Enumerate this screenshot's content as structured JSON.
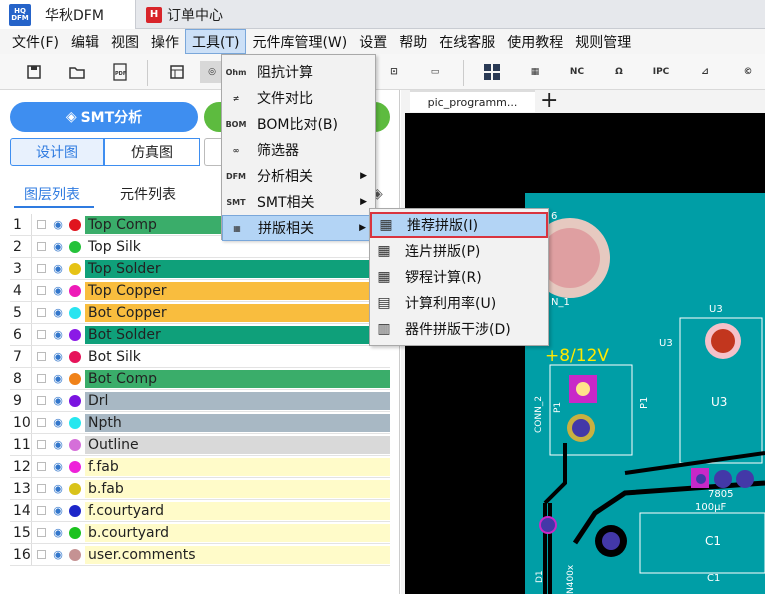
{
  "app_tabs": [
    {
      "logo": "HQ DFM",
      "label": "华秋DFM"
    },
    {
      "logo": "H",
      "label": "订单中心"
    }
  ],
  "menu": [
    "文件(F)",
    "编辑",
    "视图",
    "操作",
    "工具(T)",
    "元件库管理(W)",
    "设置",
    "帮助",
    "在线客服",
    "使用教程",
    "规则管理"
  ],
  "toolbar_icons": [
    "save-icon",
    "open-icon",
    "pdf-icon",
    "layout-icon",
    "ohm-icon",
    "ohm2-icon",
    "component-icon",
    "ruler-icon",
    "panel-icon",
    "grid-icon",
    "nc-icon",
    "ohm-icon",
    "ipc-icon",
    "probe-icon",
    "copyright-icon"
  ],
  "left": {
    "smt_button": "SMT分析",
    "seg_design": "设计图",
    "seg_sim": "仿真图",
    "tab_layers": "图层列表",
    "tab_components": "元件列表",
    "layers": [
      {
        "n": "1",
        "name": "Top Comp",
        "dot": "#e0141e",
        "bg": "#3aad6a"
      },
      {
        "n": "2",
        "name": "Top Silk",
        "dot": "#25c23a",
        "bg": "#ffffff"
      },
      {
        "n": "3",
        "name": "Top Solder",
        "dot": "#e6c315",
        "bg": "#0fa07a"
      },
      {
        "n": "4",
        "name": "Top Copper",
        "dot": "#ee1ab7",
        "bg": "#f9bd3e"
      },
      {
        "n": "5",
        "name": "Bot Copper",
        "dot": "#2ae4f0",
        "bg": "#f9bd3e"
      },
      {
        "n": "6",
        "name": "Bot Solder",
        "dot": "#8b1ae6",
        "bg": "#0fa07a"
      },
      {
        "n": "7",
        "name": "Bot Silk",
        "dot": "#e6145a",
        "bg": "#ffffff"
      },
      {
        "n": "8",
        "name": "Bot Comp",
        "dot": "#f08219",
        "bg": "#3aad6a"
      },
      {
        "n": "9",
        "name": "Drl",
        "dot": "#7a14e0",
        "bg": "#a8b8c4"
      },
      {
        "n": "10",
        "name": "Npth",
        "dot": "#27e7ef",
        "bg": "#a8b8c4"
      },
      {
        "n": "11",
        "name": "Outline",
        "dot": "#d56fd9",
        "bg": "#d9d9d9"
      },
      {
        "n": "12",
        "name": "f.fab",
        "dot": "#ee22d9",
        "bg": "#fffbc9"
      },
      {
        "n": "13",
        "name": "b.fab",
        "dot": "#d9c31a",
        "bg": "#fffbc9"
      },
      {
        "n": "14",
        "name": "f.courtyard",
        "dot": "#1d26c9",
        "bg": "#fffbc9"
      },
      {
        "n": "15",
        "name": "b.courtyard",
        "dot": "#1cc21f",
        "bg": "#fffbc9"
      },
      {
        "n": "16",
        "name": "user.comments",
        "dot": "#c59293",
        "bg": "#fffbc9"
      }
    ]
  },
  "tools_menu": [
    {
      "icon": "Ohm",
      "label": "阻抗计算",
      "arrow": false
    },
    {
      "icon": "≠",
      "label": "文件对比",
      "arrow": false
    },
    {
      "icon": "BOM",
      "label": "BOM比对(B)",
      "arrow": false
    },
    {
      "icon": "∞",
      "label": "筛选器",
      "arrow": false
    },
    {
      "icon": "DFM",
      "label": "分析相关",
      "arrow": true
    },
    {
      "icon": "SMT",
      "label": "SMT相关",
      "arrow": true
    },
    {
      "icon": "▦",
      "label": "拼版相关",
      "arrow": true
    }
  ],
  "panel_submenu": [
    {
      "icon": "▦",
      "label": "推荐拼版(I)"
    },
    {
      "icon": "▦",
      "label": "连片拼版(P)"
    },
    {
      "icon": "▦",
      "label": "锣程计算(R)"
    },
    {
      "icon": "▤",
      "label": "计算利用率(U)"
    },
    {
      "icon": "▥",
      "label": "器件拼版干涉(D)"
    }
  ],
  "pcb": {
    "tab": "pic_programm...",
    "plus": "+",
    "label_voltage": "+8/12V",
    "label_u3_top": "U3",
    "label_u3_mid": "U3",
    "label_u3_body": "U3",
    "label_p1": "P1",
    "label_p1b": "P1",
    "label_conn": "CONN_2",
    "label_conn2": "N_1",
    "label_c1": "C1",
    "label_c1b": "C1",
    "label_7805": "7805",
    "label_100": "100µF",
    "label_d1": "D1",
    "label_n400": "N400x",
    "label_6": "6"
  }
}
